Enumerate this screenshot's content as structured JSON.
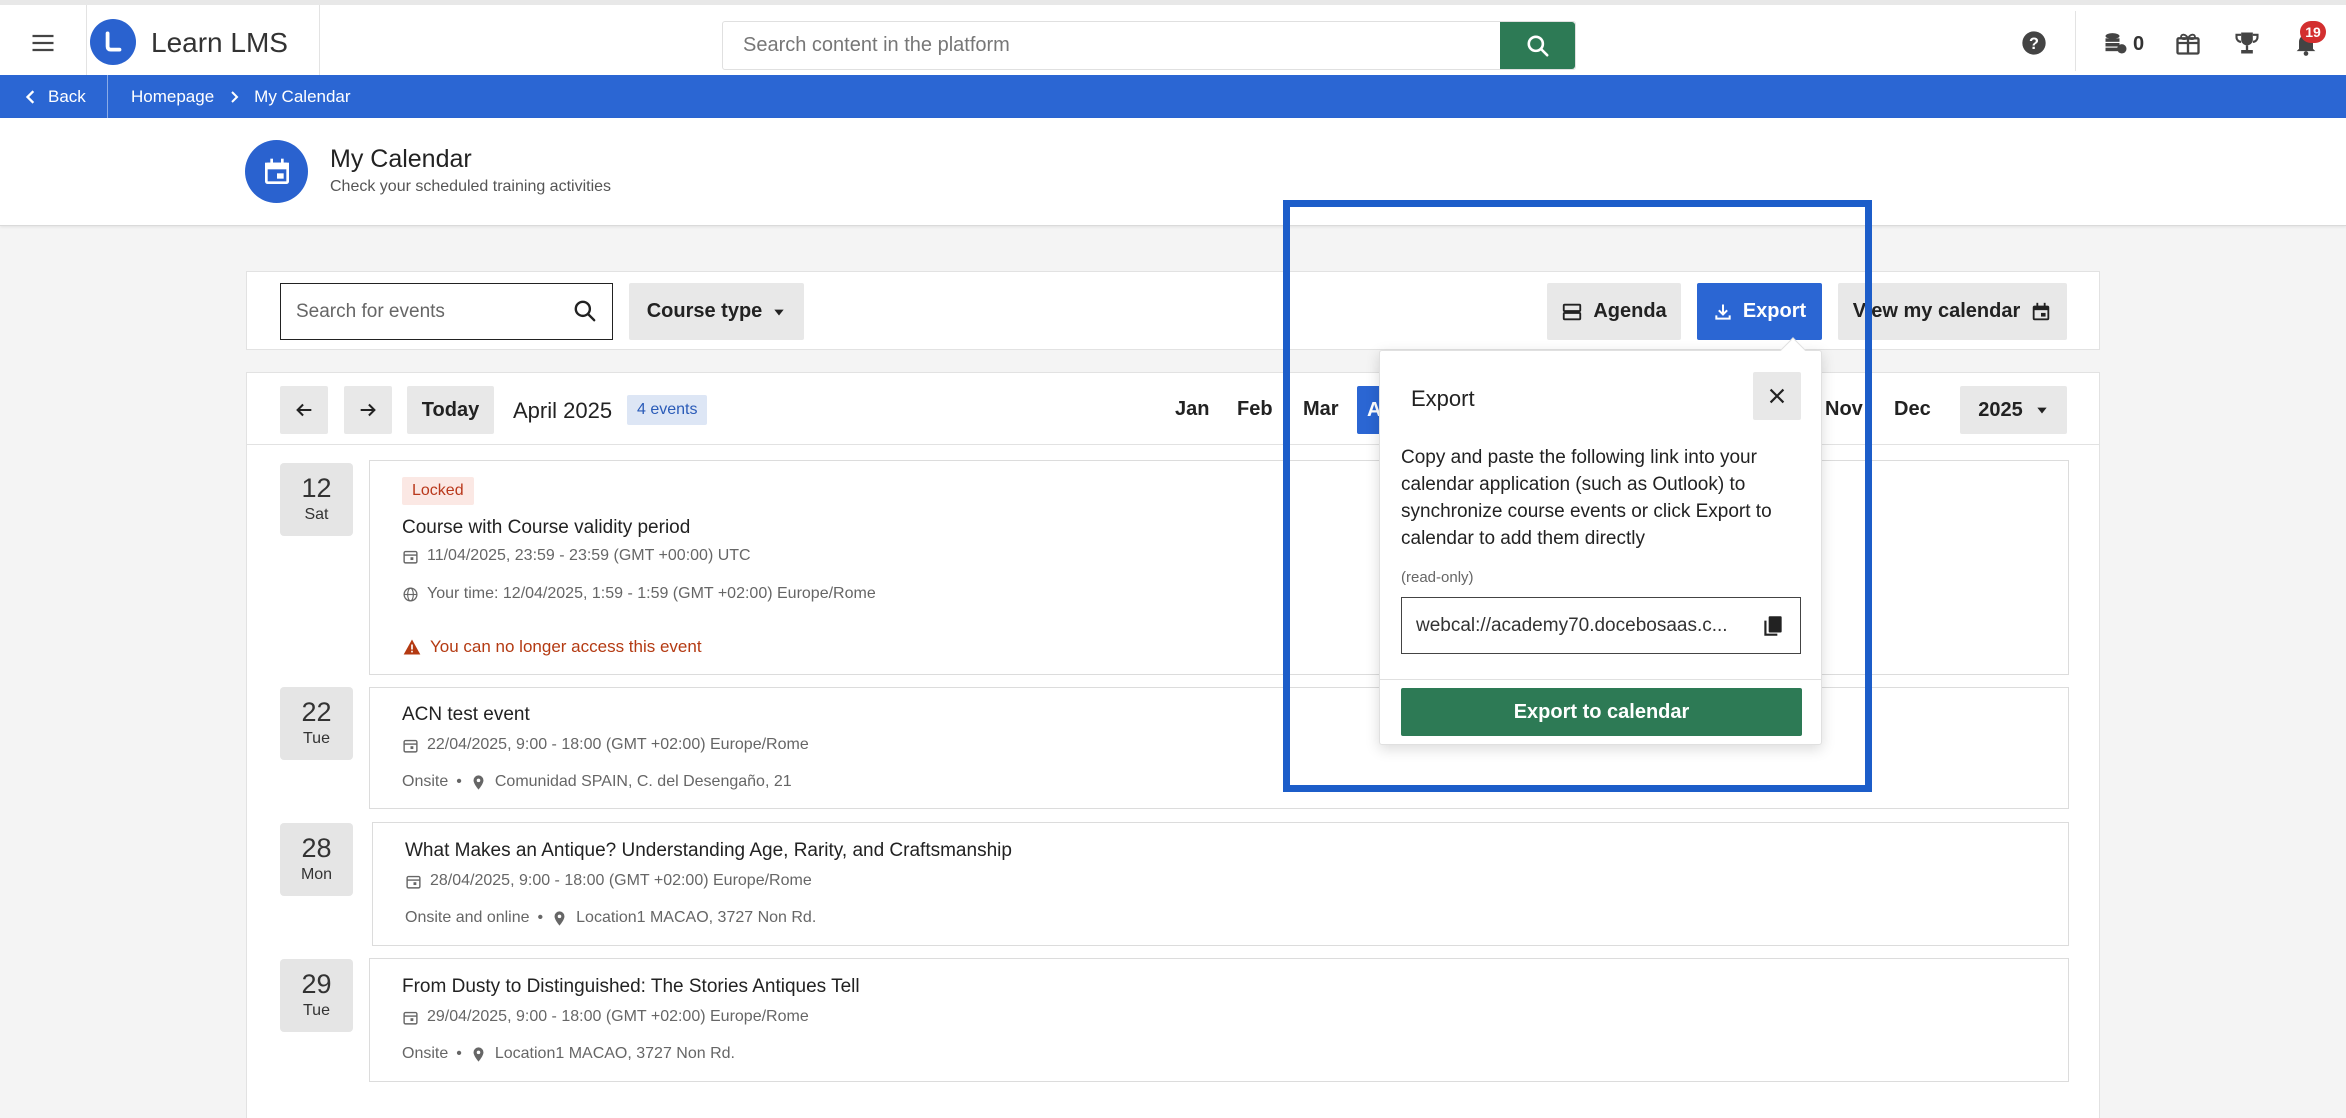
{
  "header": {
    "brand": "Learn LMS",
    "search_placeholder": "Search content in the platform",
    "coins": "0",
    "notifications": "19"
  },
  "breadcrumb": {
    "back": "Back",
    "items": [
      "Homepage",
      "My Calendar"
    ]
  },
  "page": {
    "title": "My Calendar",
    "subtitle": "Check your scheduled training activities"
  },
  "filters": {
    "search_placeholder": "Search for events",
    "course_type": "Course type",
    "agenda": "Agenda",
    "export": "Export",
    "view_calendar": "View my calendar"
  },
  "calendar": {
    "today": "Today",
    "month_label": "April 2025",
    "events_count": "4 events",
    "months_visible": [
      "Jan",
      "Feb",
      "Mar",
      "A",
      "Nov",
      "Dec"
    ],
    "year": "2025",
    "events": [
      {
        "day": "12",
        "dow": "Sat",
        "tag": "Locked",
        "title": "Course with Course validity period",
        "time": "11/04/2025, 23:59 - 23:59 (GMT +00:00) UTC",
        "your_time": "Your time: 12/04/2025, 1:59 - 1:59 (GMT +02:00) Europe/Rome",
        "warning": "You can no longer access this event"
      },
      {
        "day": "22",
        "dow": "Tue",
        "title": "ACN test event",
        "time": "22/04/2025, 9:00 - 18:00 (GMT +02:00) Europe/Rome",
        "mode": "Onsite",
        "location": "Comunidad SPAIN, C. del Desengaño, 21"
      },
      {
        "day": "28",
        "dow": "Mon",
        "title": "What Makes an Antique? Understanding Age, Rarity, and Craftsmanship",
        "time": "28/04/2025, 9:00 - 18:00 (GMT +02:00) Europe/Rome",
        "mode": "Onsite and online",
        "location": "Location1 MACAO, 3727 Non Rd."
      },
      {
        "day": "29",
        "dow": "Tue",
        "title": "From Dusty to Distinguished: The Stories Antiques Tell",
        "time": "29/04/2025, 9:00 - 18:00 (GMT +02:00) Europe/Rome",
        "mode": "Onsite",
        "location": "Location1 MACAO, 3727 Non Rd."
      }
    ]
  },
  "export_popover": {
    "title": "Export",
    "description": "Copy and paste the following link into your calendar application (such as Outlook) to synchronize course events or click Export to calendar to add them directly",
    "readonly_label": "(read-only)",
    "link_value": "webcal://academy70.docebosaas.c...",
    "button": "Export to calendar"
  },
  "colors": {
    "primary_blue": "#2b66d3",
    "action_green": "#2d7a55",
    "warning_red": "#b43a12",
    "badge_red": "#d32f2f"
  },
  "icons": [
    "menu-icon",
    "logo-icon",
    "search-icon",
    "help-icon",
    "coins-icon",
    "gift-icon",
    "trophy-icon",
    "bell-icon",
    "chevron-left-icon",
    "chevron-right-icon",
    "calendar-icon",
    "caret-down-icon",
    "agenda-icon",
    "download-icon",
    "arrow-left-icon",
    "arrow-right-icon",
    "close-icon",
    "copy-icon",
    "globe-icon",
    "warning-icon",
    "location-pin-icon"
  ]
}
